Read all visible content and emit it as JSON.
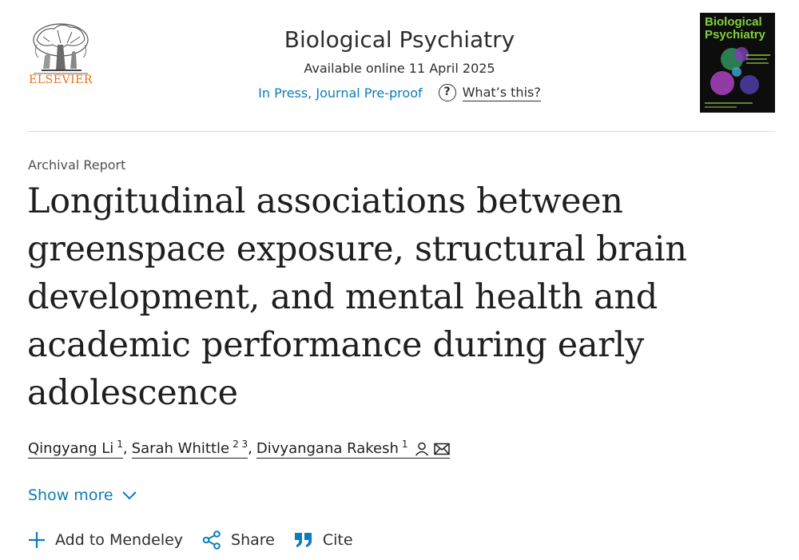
{
  "publisher": {
    "name": "ELSEVIER"
  },
  "journal": {
    "title": "Biological Psychiatry",
    "available": "Available online 11 April 2025",
    "status": "In Press, Journal Pre-proof",
    "whats_this": "What’s this?",
    "cover_title": "Biological Psychiatry"
  },
  "article": {
    "type": "Archival Report",
    "title": "Longitudinal associations between greenspace exposure, structural brain development, and mental health and academic performance during early adolescence"
  },
  "authors": [
    {
      "name": "Qingyang Li",
      "sup": "1"
    },
    {
      "name": "Sarah Whittle",
      "sup": "2 3"
    },
    {
      "name": "Divyangana Rakesh",
      "sup": "1"
    }
  ],
  "show_more": "Show more",
  "actions": {
    "mendeley": "Add to Mendeley",
    "share": "Share",
    "cite": "Cite"
  },
  "colors": {
    "link": "#0c7dbb",
    "publisher": "#e9711c",
    "cover_title": "#7fd23c"
  }
}
